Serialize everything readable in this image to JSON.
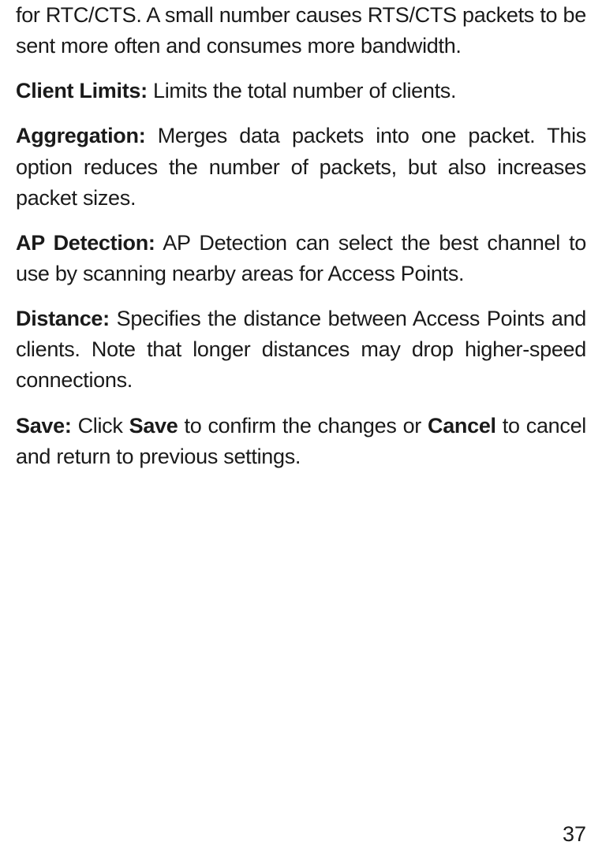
{
  "paragraphs": {
    "p1_text": "for RTC/CTS. A small number causes RTS/CTS packets to be sent more often and consumes more bandwidth.",
    "p2_term": "Client Limits:",
    "p2_text": " Limits the total number of clients.",
    "p3_term": "Aggregation:",
    "p3_text": " Merges data packets into one packet. This option reduces the number of packets, but also increases packet sizes.",
    "p4_term": "AP Detection:",
    "p4_text": " AP Detection can select the best channel to use by scanning nearby areas for Access Points.",
    "p5_term": "Distance:",
    "p5_text": " Specifies the distance between Access Points and clients. Note that longer distances may drop higher-speed connections.",
    "p6_term": "Save:",
    "p6_text1": " Click ",
    "p6_bold1": "Save",
    "p6_text2": " to confirm the changes or ",
    "p6_bold2": "Cancel",
    "p6_text3": " to cancel and return to previous settings."
  },
  "page_number": "37"
}
